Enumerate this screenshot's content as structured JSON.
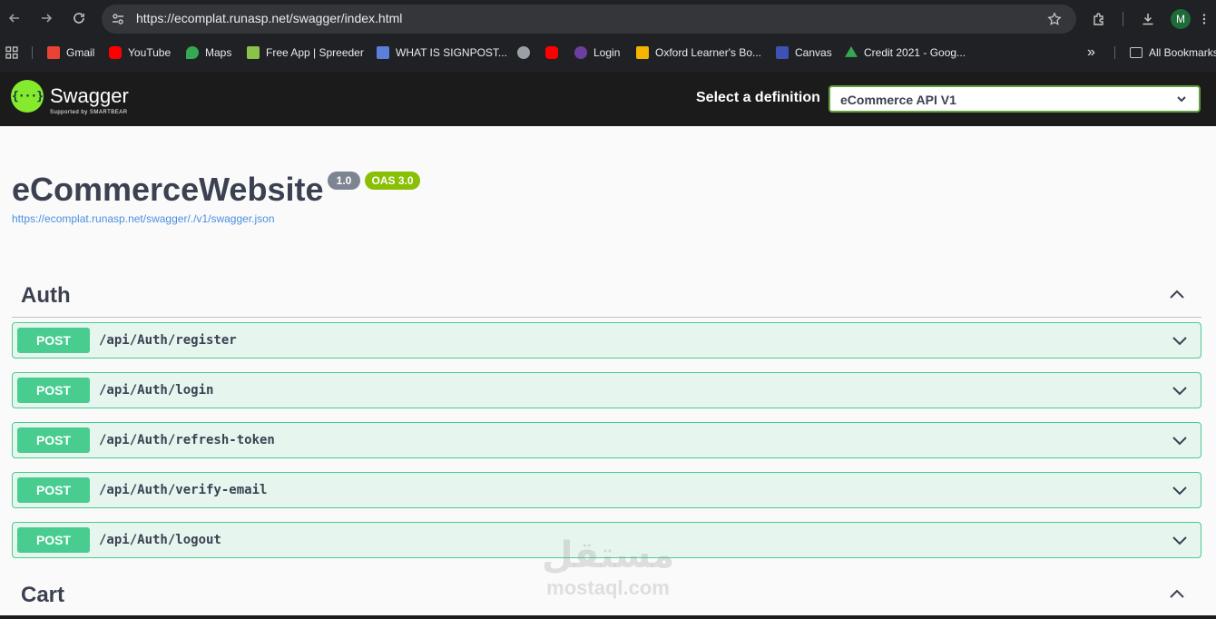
{
  "browser": {
    "url": "https://ecomplat.runasp.net/swagger/index.html",
    "avatar_letter": "M",
    "bookmarks": [
      {
        "label": "Gmail",
        "color": "#ea4335"
      },
      {
        "label": "YouTube",
        "color": "#ff0000"
      },
      {
        "label": "Maps",
        "color": "#34a853"
      },
      {
        "label": "Free App | Spreeder",
        "color": "#8bc34a"
      },
      {
        "label": "WHAT IS SIGNPOST...",
        "color": "#5b7fdb"
      },
      {
        "label": "",
        "color": "#9aa0a6"
      },
      {
        "label": "",
        "color": "#ff0000"
      },
      {
        "label": "Login",
        "color": "#6b3fa0"
      },
      {
        "label": "Oxford Learner's Bo...",
        "color": "#f4b400"
      },
      {
        "label": "Canvas",
        "color": "#3f51b5"
      },
      {
        "label": "Credit 2021 - Goog...",
        "color": "#34a853"
      }
    ],
    "more_bookmarks": "»",
    "all_bookmarks": "All Bookmarks"
  },
  "topbar": {
    "brand": "Swagger",
    "brand_sub": "Supported by SMARTBEAR",
    "definition_label": "Select a definition",
    "definition_value": "eCommerce API V1"
  },
  "info": {
    "title": "eCommerceWebsite",
    "version": "1.0",
    "oas": "OAS 3.0",
    "spec_url": "https://ecomplat.runasp.net/swagger/./v1/swagger.json"
  },
  "tags": [
    {
      "name": "Auth",
      "operations": [
        {
          "method": "POST",
          "path": "/api/Auth/register"
        },
        {
          "method": "POST",
          "path": "/api/Auth/login"
        },
        {
          "method": "POST",
          "path": "/api/Auth/refresh-token"
        },
        {
          "method": "POST",
          "path": "/api/Auth/verify-email"
        },
        {
          "method": "POST",
          "path": "/api/Auth/logout"
        }
      ]
    },
    {
      "name": "Cart",
      "operations": []
    }
  ],
  "watermark": {
    "arabic": "مستقل",
    "latin": "mostaql.com"
  }
}
